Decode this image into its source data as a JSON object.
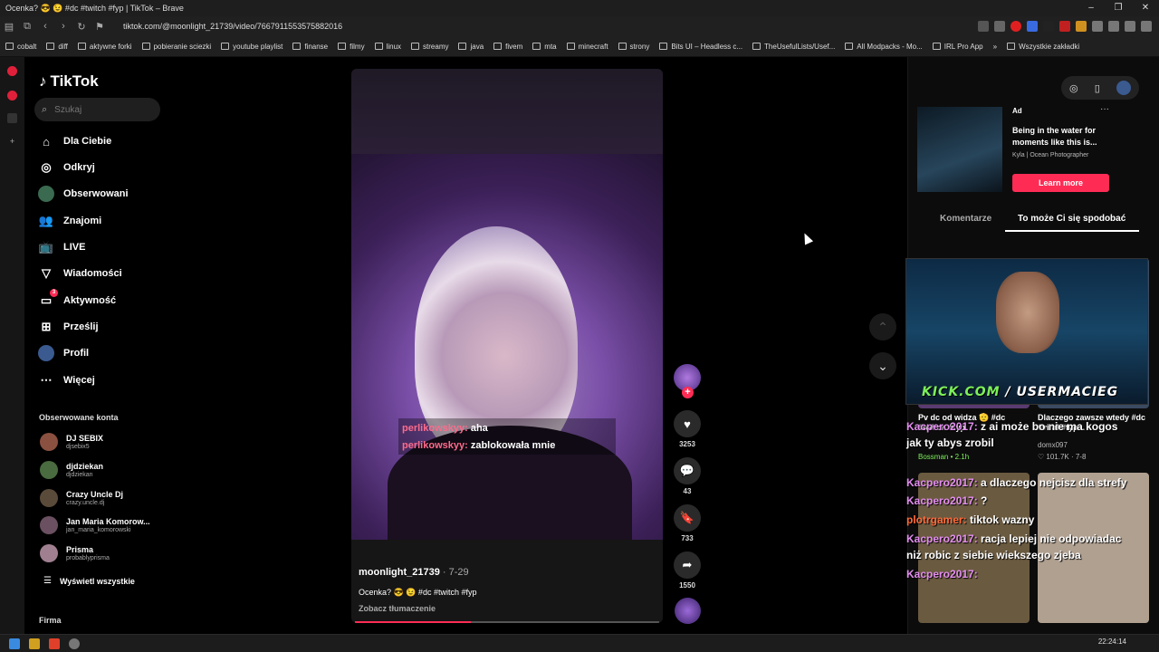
{
  "window": {
    "title": "Ocenka? 😎 😉 #dc #twitch #fyp | TikTok – Brave",
    "controls": [
      "–",
      "❐",
      "✕"
    ]
  },
  "browser": {
    "url": "tiktok.com/@moonlight_21739/video/7667911553575882016",
    "bookmarks": [
      "cobalt",
      "diff",
      "aktywne forki",
      "pobieranie sciezki",
      "youtube playlist",
      "finanse",
      "filmy",
      "linux",
      "streamy",
      "java",
      "fivem",
      "mta",
      "minecraft",
      "strony",
      "Bits UI – Headless c...",
      "TheUsefulLists/Usef...",
      "All Modpacks - Mo...",
      "IRL Pro App",
      "»",
      "Wszystkie zakładki"
    ]
  },
  "tiktok": {
    "logo": "TikTok",
    "search_placeholder": "Szukaj",
    "nav": [
      {
        "label": "Dla Ciebie",
        "icon": "home-icon"
      },
      {
        "label": "Odkryj",
        "icon": "compass-icon"
      },
      {
        "label": "Obserwowani",
        "icon": "avatar-icon"
      },
      {
        "label": "Znajomi",
        "icon": "friends-icon"
      },
      {
        "label": "LIVE",
        "icon": "live-icon"
      },
      {
        "label": "Wiadomości",
        "icon": "send-icon"
      },
      {
        "label": "Aktywność",
        "icon": "activity-icon",
        "badge": "3"
      },
      {
        "label": "Prześlij",
        "icon": "upload-icon"
      },
      {
        "label": "Profil",
        "icon": "profile-icon"
      },
      {
        "label": "Więcej",
        "icon": "more-icon"
      }
    ],
    "followed_heading": "Obserwowane konta",
    "followed": [
      {
        "name": "DJ SEBIX",
        "user": "djsebix5"
      },
      {
        "name": "djdziekan",
        "user": "djdziekan"
      },
      {
        "name": "Crazy Uncle Dj",
        "user": "crazy.uncle.dj"
      },
      {
        "name": "Jan Maria Komorow...",
        "user": "jan_maria_komorowski"
      },
      {
        "name": "Prisma",
        "user": "probablyprisma"
      }
    ],
    "show_all": "Wyświetl wszystkie",
    "footer_heading": "Firma"
  },
  "video": {
    "author": "moonlight_21739",
    "date": " · 7-29",
    "caption": "Ocenka? 😎 😉  #dc #twitch #fyp",
    "translate": "Zobacz tłumaczenie",
    "progress": 0.38,
    "overlay_chat": [
      {
        "user": "perlikowskyy:",
        "msg": "aha"
      },
      {
        "user": "perlikowskyy:",
        "msg": "zablokowała mnie"
      }
    ],
    "likes": "3253",
    "comments": "43",
    "saves": "733",
    "shares": "1550",
    "follow_plus": "+"
  },
  "right": {
    "ad": {
      "label": "Ad",
      "more": "···",
      "title": "Being in the water for moments like this is...",
      "subtitle": "Kyla | Ocean Photographer",
      "cta": "Learn more"
    },
    "tabs": [
      "Komentarze",
      "To może Ci się spodobać"
    ],
    "thumbs": [
      {
        "caption": "Pv dc od widza 🫡 #dc #twitch #fyp",
        "user": "Bossman • 2.1h"
      },
      {
        "caption": "Dlaczego zawsze wtedy #dc #viral #fyp...",
        "user": "domx097",
        "stats": "♡ 101.7K · 7-8"
      }
    ]
  },
  "stream_overlay": {
    "kick_domain": "KICK.COM",
    "kick_user": "USERMACIEG",
    "chat": [
      {
        "user": "Kacpero2017:",
        "msg": " z ai może bo nie ma kogos"
      },
      {
        "user": "",
        "msg": "jak ty abys zrobil"
      },
      {
        "user": "Kacpero2017:",
        "msg": " a dlaczego nejcisz dla strefy"
      },
      {
        "user": "Kacpero2017:",
        "msg": " ?"
      },
      {
        "user": "plotrgamer:",
        "msg": " tiktok wazny"
      },
      {
        "user": "Kacpero2017:",
        "msg": " racja lepiej nie odpowiadac"
      },
      {
        "user": "",
        "msg": "niż robic z siebie wiekszego zjeba"
      },
      {
        "user": "Kacpero2017:",
        "msg": ""
      }
    ]
  },
  "taskbar": {
    "clock": "22:24:14"
  }
}
